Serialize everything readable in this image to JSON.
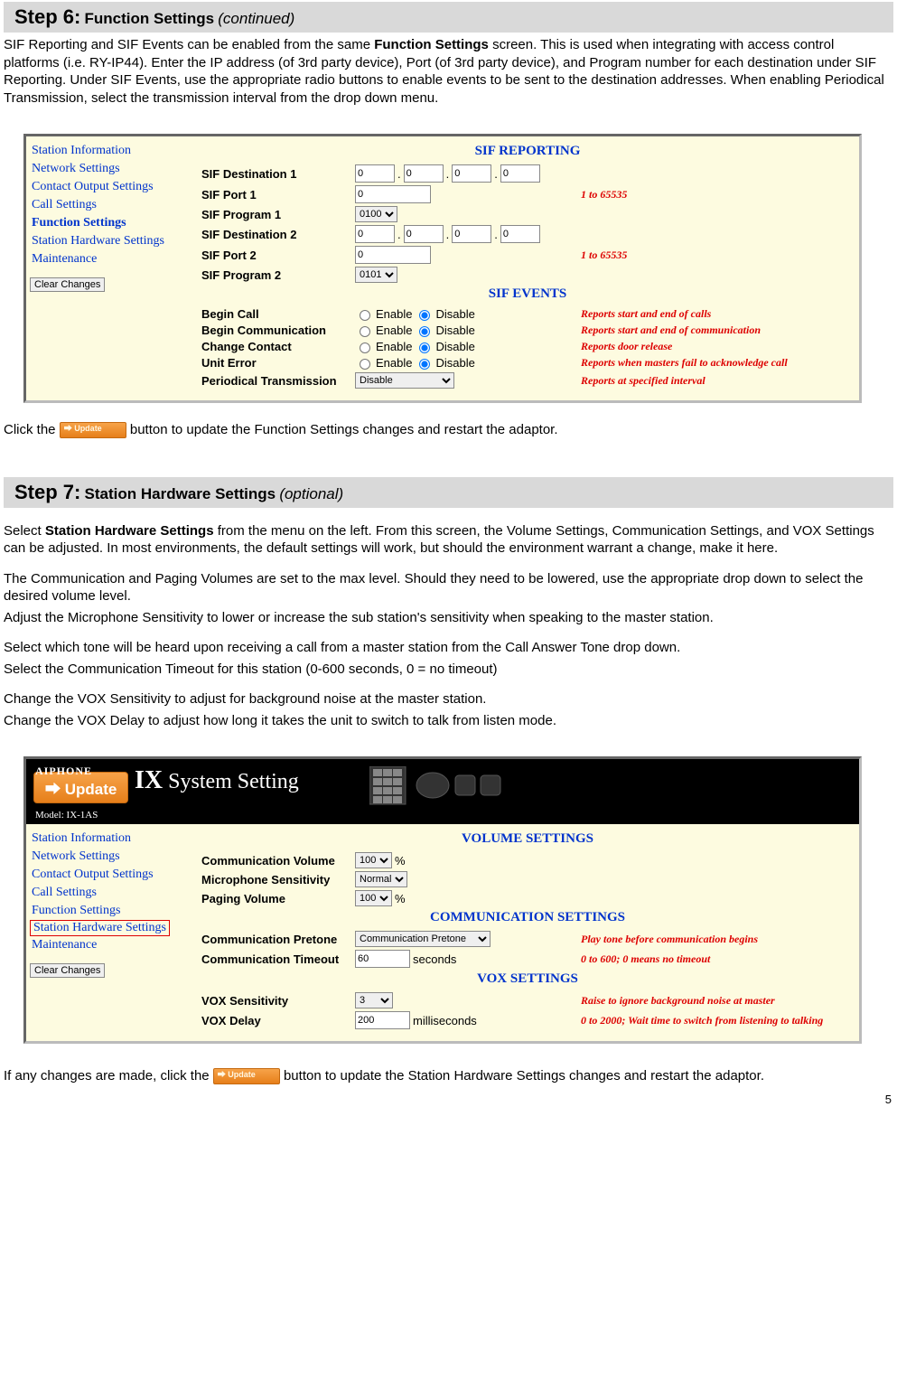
{
  "step6": {
    "num": "Step 6:",
    "title": "Function Settings",
    "note": "(continued)",
    "para": {
      "a": "SIF Reporting and SIF Events can be enabled from the same ",
      "b": "Function Settings",
      "c": " screen. This is used when integrating with access control platforms (i.e. RY-IP44). Enter the IP address (of 3rd party device), Port (of 3rd party device), and Program number for each destination under SIF Reporting. Under SIF Events, use the appropriate radio buttons to enable events to be sent to the destination addresses. When enabling Periodical Transmission, select the transmission interval from the drop down menu."
    },
    "click": {
      "a": "Click the ",
      "b": " button to update the Function Settings changes and restart the adaptor."
    }
  },
  "panel1": {
    "nav": [
      "Station Information",
      "Network Settings",
      "Contact Output Settings",
      "Call Settings",
      "Function Settings",
      "Station Hardware Settings",
      "Maintenance"
    ],
    "clear": "Clear Changes",
    "sifReporting": "SIF REPORTING",
    "sifEvents": "SIF EVENTS",
    "rows": {
      "dest1": "SIF Destination 1",
      "port1": "SIF Port 1",
      "prog1": "SIF Program 1",
      "dest2": "SIF Destination 2",
      "port2": "SIF Port 2",
      "prog2": "SIF Program 2"
    },
    "hints": {
      "port": "1 to 65535"
    },
    "ipval": "0",
    "portval": "0",
    "prog1sel": "0100",
    "prog2sel": "0101",
    "events": {
      "beginCall": {
        "lbl": "Begin Call",
        "hint": "Reports start and end of calls"
      },
      "beginComm": {
        "lbl": "Begin Communication",
        "hint": "Reports start and end of communication"
      },
      "changeContact": {
        "lbl": "Change Contact",
        "hint": "Reports door release"
      },
      "unitError": {
        "lbl": "Unit Error",
        "hint": "Reports when masters fail to acknowledge call"
      },
      "periodical": {
        "lbl": "Periodical Transmission",
        "hint": "Reports at specified interval",
        "sel": "Disable"
      }
    },
    "enable": "Enable",
    "disable": "Disable"
  },
  "step7": {
    "num": "Step 7:",
    "title": "Station Hardware Settings",
    "note": "(optional)",
    "p1": {
      "a": "Select ",
      "b": "Station Hardware Settings",
      "c": " from the menu on the left. From this screen, the Volume Settings, Communication Settings, and VOX Settings can be adjusted. In most environments, the default settings will work, but should the environment warrant a change, make it here."
    },
    "p2": "The Communication and Paging Volumes are set to the max level. Should they need to be lowered, use the appropriate drop down to select the desired volume level.",
    "p3": "Adjust the Microphone Sensitivity to lower or increase the sub station's sensitivity when speaking to the master station.",
    "p4": "Select which tone will be heard upon receiving a call from a master station from the Call Answer Tone drop down.",
    "p5": "Select the Communication Timeout for this station (0-600 seconds, 0 = no timeout)",
    "p6": "Change the VOX Sensitivity to adjust for background noise at the master station.",
    "p7": "Change the VOX Delay to adjust how long it takes the unit to switch to talk from listen mode.",
    "click": {
      "a": "If any changes are made, click the ",
      "b": " button to update the Station Hardware Settings changes and restart the adaptor."
    }
  },
  "panel2": {
    "brand": "AIPHONE",
    "ix": "IX",
    "sys": "System Setting",
    "model": "Model: IX-1AS",
    "update": "Update",
    "nav": [
      "Station Information",
      "Network Settings",
      "Contact Output Settings",
      "Call Settings",
      "Function Settings",
      "Station Hardware Settings",
      "Maintenance"
    ],
    "clear": "Clear Changes",
    "vol": "VOLUME SETTINGS",
    "comm": "COMMUNICATION SETTINGS",
    "vox": "VOX SETTINGS",
    "rows": {
      "commVol": {
        "lbl": "Communication Volume",
        "val": "100",
        "unit": "%"
      },
      "micSens": {
        "lbl": "Microphone Sensitivity",
        "val": "Normal"
      },
      "pagVol": {
        "lbl": "Paging Volume",
        "val": "100",
        "unit": "%"
      },
      "commPre": {
        "lbl": "Communication Pretone",
        "val": "Communication Pretone",
        "hint": "Play tone before communication begins"
      },
      "commTO": {
        "lbl": "Communication Timeout",
        "val": "60",
        "unit": "seconds",
        "hint": "0 to 600; 0 means no timeout"
      },
      "voxSens": {
        "lbl": "VOX Sensitivity",
        "val": "3",
        "hint": "Raise to ignore background noise at master"
      },
      "voxDel": {
        "lbl": "VOX Delay",
        "val": "200",
        "unit": "milliseconds",
        "hint": "0 to 2000; Wait time to switch from listening to talking"
      }
    }
  },
  "pagenum": "5"
}
